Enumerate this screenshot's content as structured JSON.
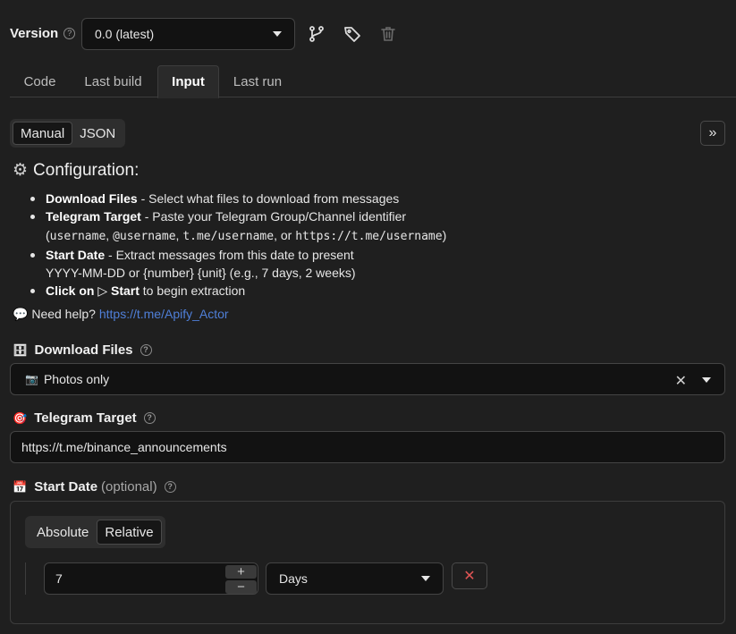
{
  "version": {
    "label": "Version",
    "help": "?",
    "selected": "0.0 (latest)"
  },
  "tabs": [
    {
      "label": "Code"
    },
    {
      "label": "Last build"
    },
    {
      "label": "Input",
      "active": true
    },
    {
      "label": "Last run"
    }
  ],
  "mode_toggle": {
    "manual": "Manual",
    "json": "JSON",
    "active": "Manual"
  },
  "expand_icon": "»",
  "config": {
    "title": "Configuration:",
    "items": [
      {
        "bold": "Download Files",
        "text": " - Select what files to download from messages"
      },
      {
        "bold": "Telegram Target",
        "text": " - Paste your Telegram Group/Channel identifier"
      },
      {
        "bold": "Start Date",
        "text": " - Extract messages from this date to present"
      },
      {
        "bold": "Click on ▷ Start",
        "text": " to begin extraction"
      }
    ],
    "target_formats": {
      "open": "(",
      "f1": "username",
      "sep1": ", ",
      "f2": "@username",
      "sep2": ", ",
      "f3": "t.me/username",
      "sep3": ", or ",
      "f4": "https://t.me/username",
      "close": ")"
    },
    "date_formats": "YYYY-MM-DD or {number} {unit} (e.g., 7 days, 2 weeks)"
  },
  "help": {
    "icon": "💬",
    "text": "Need help?",
    "link": "https://t.me/Apify_Actor"
  },
  "download_files": {
    "icon": "🗄",
    "label": "Download Files",
    "value_icon": "📷",
    "value": "Photos only",
    "clear": "✕"
  },
  "telegram_target": {
    "icon": "🎯",
    "label": "Telegram Target",
    "value": "https://t.me/binance_announcements"
  },
  "start_date": {
    "icon": "📅",
    "label": "Start Date",
    "optional": "(optional)",
    "modes": {
      "absolute": "Absolute",
      "relative": "Relative",
      "active": "Relative"
    },
    "amount": "7",
    "plus": "+",
    "minus": "−",
    "unit": "Days",
    "remove": "✕"
  },
  "colors": {
    "background": "#1f1f1f",
    "input_bg": "#121212",
    "link": "#4f7fd8",
    "danger": "#e05555"
  }
}
